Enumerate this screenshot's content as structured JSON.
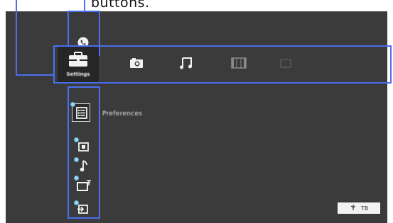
{
  "caption": "buttons.",
  "menu": {
    "items": [
      {
        "id": "settings",
        "icon": "toolbox-icon",
        "label": "Settings",
        "active": true
      },
      {
        "id": "photo",
        "icon": "camera-icon",
        "label": "",
        "active": false
      },
      {
        "id": "music",
        "icon": "music-note-icon",
        "label": "",
        "active": false
      },
      {
        "id": "video",
        "icon": "film-icon",
        "label": "",
        "active": false
      },
      {
        "id": "tv",
        "icon": "tv-icon",
        "label": "",
        "active": false
      }
    ]
  },
  "top_icon": "phone-icon",
  "submenu": {
    "selected_label": "Preferences",
    "items": [
      {
        "id": "preferences",
        "icon": "list-icon"
      },
      {
        "id": "display",
        "icon": "display-icon"
      },
      {
        "id": "audio",
        "icon": "audio-note-icon"
      },
      {
        "id": "screen",
        "icon": "screen-icon"
      },
      {
        "id": "input",
        "icon": "input-icon"
      }
    ]
  },
  "status": {
    "icon": "antenna-icon",
    "text": "TB"
  },
  "colors": {
    "accent": "#4a6ef0",
    "background": "#3b3b3b",
    "active_bg": "#262626"
  }
}
